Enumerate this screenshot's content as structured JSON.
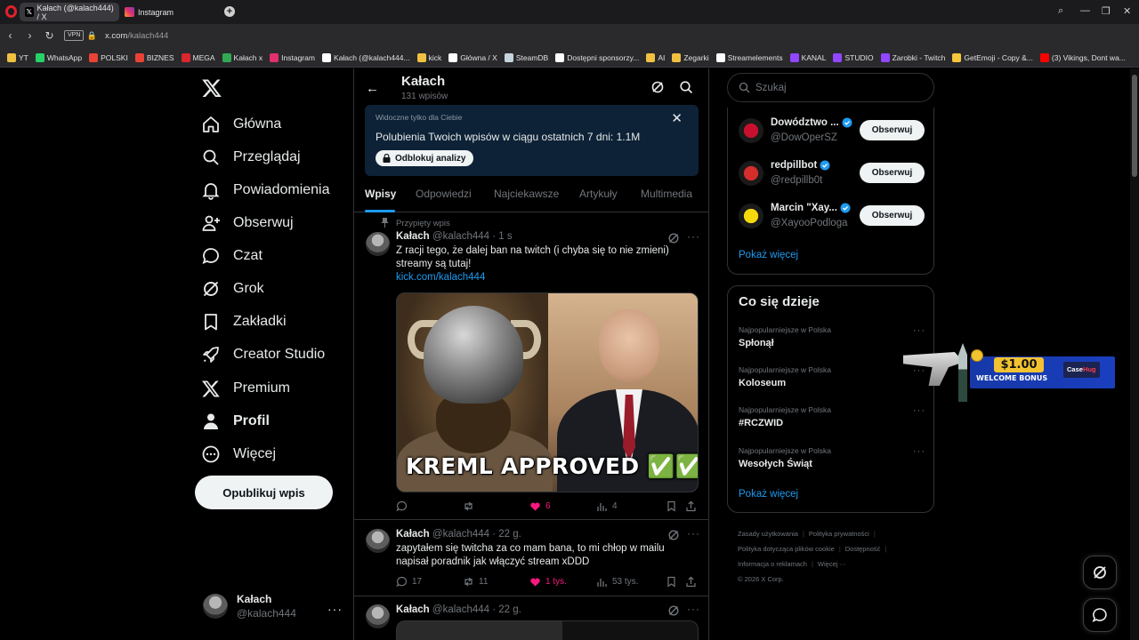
{
  "browser": {
    "tabs": [
      {
        "title": "Kałach (@kalach444) / X",
        "active": true,
        "icon": "x-logo-icon"
      },
      {
        "title": "Instagram",
        "active": false,
        "icon": "instagram-icon"
      }
    ],
    "vpn_label": "VPN",
    "url_host": "x.com",
    "url_path": "/kalach444",
    "bookmarks": [
      {
        "label": "YT",
        "color": "#f0c040"
      },
      {
        "label": "WhatsApp",
        "color": "#25d366"
      },
      {
        "label": "POLSKI",
        "color": "#ea4335"
      },
      {
        "label": "BIZNES",
        "color": "#ea4335"
      },
      {
        "label": "MEGA",
        "color": "#d9272e"
      },
      {
        "label": "Kałach x",
        "color": "#34a853"
      },
      {
        "label": "Instagram",
        "color": "#e1306c"
      },
      {
        "label": "Kałach (@kalach444...",
        "color": "#ffffff"
      },
      {
        "label": "kick",
        "color": "#f0c040"
      },
      {
        "label": "Główna / X",
        "color": "#ffffff"
      },
      {
        "label": "SteamDB",
        "color": "#c6d4df"
      },
      {
        "label": "Dostępni sponsorzy...",
        "color": "#ffffff"
      },
      {
        "label": "AI",
        "color": "#f0c040"
      },
      {
        "label": "Zegarki",
        "color": "#f0c040"
      },
      {
        "label": "Streamelements",
        "color": "#ffffff"
      },
      {
        "label": "KANAL",
        "color": "#9146ff"
      },
      {
        "label": "STUDIO",
        "color": "#9146ff"
      },
      {
        "label": "Zarobki - Twitch",
        "color": "#9146ff"
      },
      {
        "label": "GetEmoji - Copy &...",
        "color": "#f6c63c"
      },
      {
        "label": "(3) Vikings, Dont wa...",
        "color": "#ff0000"
      }
    ]
  },
  "nav": {
    "items": [
      {
        "label": "Główna",
        "icon": "home-icon"
      },
      {
        "label": "Przeglądaj",
        "icon": "search-icon"
      },
      {
        "label": "Powiadomienia",
        "icon": "bell-icon"
      },
      {
        "label": "Obserwuj",
        "icon": "add-user-icon"
      },
      {
        "label": "Czat",
        "icon": "chat-icon"
      },
      {
        "label": "Grok",
        "icon": "grok-icon"
      },
      {
        "label": "Zakładki",
        "icon": "bookmark-icon"
      },
      {
        "label": "Creator Studio",
        "icon": "rocket-icon"
      },
      {
        "label": "Premium",
        "icon": "x-logo-icon"
      },
      {
        "label": "Profil",
        "icon": "person-icon"
      },
      {
        "label": "Więcej",
        "icon": "more-circle-icon"
      }
    ],
    "post_button": "Opublikuj wpis",
    "account": {
      "name": "Kałach",
      "handle": "@kalach444"
    }
  },
  "profile": {
    "name": "Kałach",
    "post_count": "131 wpisów",
    "banner": {
      "visibility": "Widoczne tylko dla Ciebie",
      "text": "Polubienia Twoich wpisów w ciągu ostatnich 7 dni: 1.1M",
      "button": "Odblokuj analizy"
    },
    "tabs": [
      "Wpisy",
      "Odpowiedzi",
      "Najciekawsze",
      "Artykuły",
      "Multimedia"
    ]
  },
  "tweets": [
    {
      "pinned_label": "Przypięty wpis",
      "name": "Kałach",
      "handle_time": "@kalach444 · 1 s",
      "text": "Z racji tego, że dalej ban na twitch (i chyba się to nie zmieni) streamy są tutaj!",
      "link": "kick.com/kalach444",
      "media_caption": "KREML APPROVED ✅✅✅",
      "replies": "",
      "retweets": "",
      "likes": "6",
      "views": "4"
    },
    {
      "name": "Kałach",
      "handle_time": "@kalach444 · 22 g.",
      "text": "zapytałem się twitcha za co mam bana, to mi chłop w mailu napisał poradnik jak włączyć stream xDDD",
      "replies": "17",
      "retweets": "11",
      "likes": "1 tys.",
      "views": "53 tys."
    },
    {
      "name": "Kałach",
      "handle_time": "@kalach444 · 22 g."
    }
  ],
  "right": {
    "search_placeholder": "Szukaj",
    "who_to_follow": [
      {
        "name": "Dowództwo ...",
        "handle": "@DowOperSZ",
        "button": "Obserwuj",
        "avatar_color": "#c8102e"
      },
      {
        "name": "redpillbot",
        "handle": "@redpillb0t",
        "button": "Obserwuj",
        "avatar_color": "#d62d2d"
      },
      {
        "name": "Marcin \"Xay...",
        "handle": "@XayooPodloga",
        "button": "Obserwuj",
        "avatar_color": "#f5d90a"
      }
    ],
    "follow_show_more": "Pokaż więcej",
    "trends_title": "Co się dzieje",
    "trends": [
      {
        "category": "Najpopularniejsze w Polska",
        "name": "Spłonął"
      },
      {
        "category": "Najpopularniejsze w Polska",
        "name": "Koloseum"
      },
      {
        "category": "Najpopularniejsze w Polska",
        "name": "#RCZWID"
      },
      {
        "category": "Najpopularniejsze w Polska",
        "name": "Wesołych Świąt"
      }
    ],
    "trends_show_more": "Pokaż więcej",
    "footer": {
      "links": [
        "Zasady użytkowania",
        "Polityka prywatności",
        "Polityka dotycząca plików cookie",
        "Dostępność",
        "Informacja o reklamach",
        "Więcej ···"
      ],
      "copyright": "© 2026 X Corp."
    }
  },
  "ad": {
    "amount": "$1.00",
    "text": "WELCOME BONUS",
    "brand_a": "Case",
    "brand_b": "Hug"
  },
  "colors": {
    "accent": "#1d9bf0",
    "like": "#f91880",
    "banner_bg": "#0d2236"
  }
}
